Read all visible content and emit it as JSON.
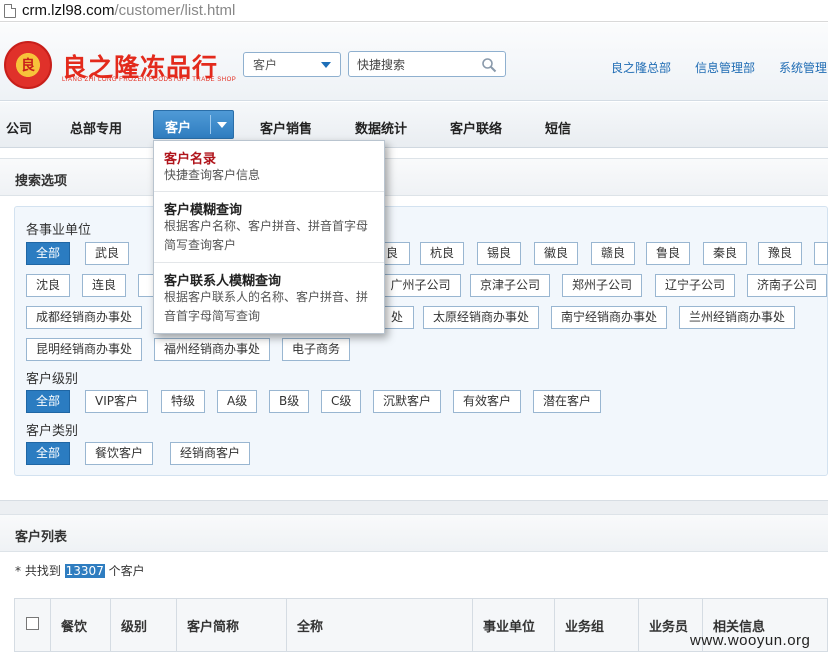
{
  "browser": {
    "url_host": "crm.lzl98.com",
    "url_path": "/customer/list.html"
  },
  "header": {
    "logo_badge_text": "良",
    "logo_title": "良之隆冻品行",
    "logo_subtitle": "LIANG ZHI LONG FROZEN FOODSTUFF TRADE SHOP",
    "search_type_value": "客户",
    "search_placeholder": "快捷搜索",
    "links": [
      "良之隆总部",
      "信息管理部",
      "系统管理"
    ]
  },
  "nav": {
    "items": [
      "公司",
      "总部专用",
      "客户",
      "客户销售",
      "数据统计",
      "客户联络",
      "短信"
    ]
  },
  "dropdown": {
    "items": [
      {
        "title": "客户名录",
        "desc": "快捷查询客户信息"
      },
      {
        "title": "客户模糊查询",
        "desc": "根据客户名称、客户拼音、拼音首字母简写查询客户"
      },
      {
        "title": "客户联系人模糊查询",
        "desc": "根据客户联系人的名称、客户拼音、拼音首字母简写查询"
      }
    ]
  },
  "search_options": {
    "title": "搜索选项",
    "unit_label": "各事业单位",
    "unit_row1": [
      "全部",
      "武良",
      "",
      "",
      "",
      "",
      "良",
      "杭良",
      "锡良",
      "徽良",
      "赣良",
      "鲁良",
      "秦良",
      "豫良",
      ""
    ],
    "unit_row2": [
      "沈良",
      "连良",
      "",
      "",
      "",
      "广州子公司",
      "京津子公司",
      "郑州子公司",
      "辽宁子公司",
      "济南子公司"
    ],
    "unit_row3": [
      "成都经销商办事处",
      "",
      "处",
      "太原经销商办事处",
      "南宁经销商办事处",
      "兰州经销商办事处"
    ],
    "unit_row4": [
      "昆明经销商办事处",
      "福州经销商办事处",
      "电子商务"
    ],
    "level_label": "客户级别",
    "levels": [
      "全部",
      "VIP客户",
      "特级",
      "A级",
      "B级",
      "C级",
      "沉默客户",
      "有效客户",
      "潜在客户"
    ],
    "type_label": "客户类别",
    "types": [
      "全部",
      "餐饮客户",
      "经销商客户"
    ]
  },
  "customer_list": {
    "title": "客户列表",
    "count_prefix": "* 共找到",
    "count": "13307",
    "count_suffix": "个客户",
    "columns": [
      "餐饮",
      "级别",
      "客户简称",
      "全称",
      "事业单位",
      "业务组",
      "业务员",
      "相关信息"
    ]
  },
  "watermark": "www.wooyun.org"
}
